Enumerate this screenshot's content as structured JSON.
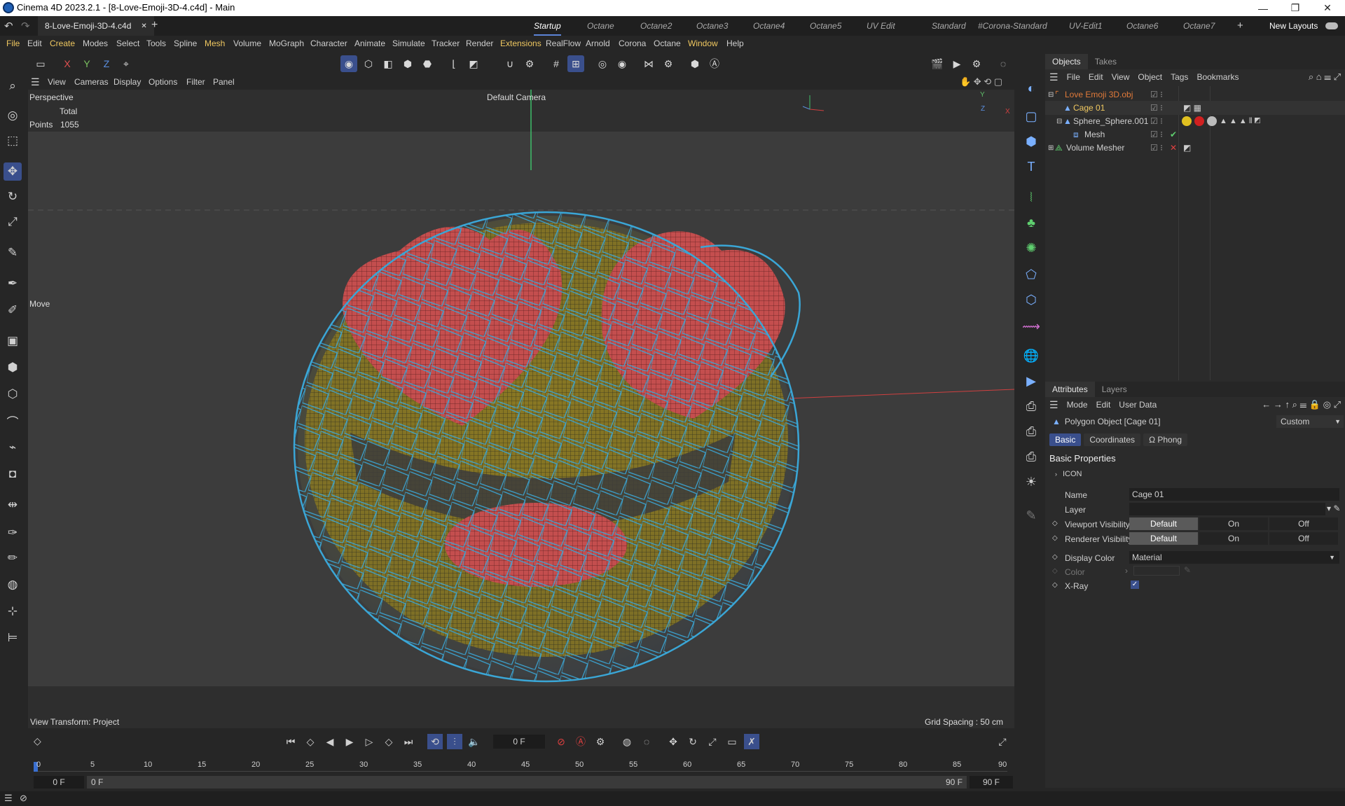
{
  "window": {
    "title": "Cinema 4D 2023.2.1 - [8-Love-Emoji-3D-4.c4d] - Main",
    "controls": [
      "—",
      "❐",
      "✕"
    ]
  },
  "doc_tab": {
    "label": "8-Love-Emoji-3D-4.c4d",
    "close": "✕",
    "add": "+"
  },
  "layout_tabs": [
    "Startup",
    "Octane",
    "Octane2",
    "Octane3",
    "Octane4",
    "Octane5",
    "UV Edit",
    "Standard",
    "#Corona-Standard",
    "UV-Edit1",
    "Octane6",
    "Octane7"
  ],
  "new_layouts": "New Layouts",
  "menus": [
    "File",
    "Edit",
    "Create",
    "Modes",
    "Select",
    "Tools",
    "Spline",
    "Mesh",
    "Volume",
    "MoGraph",
    "Character",
    "Animate",
    "Simulate",
    "Tracker",
    "Render",
    "Extensions",
    "RealFlow",
    "Arnold",
    "Corona",
    "Octane",
    "Window",
    "Help"
  ],
  "axis_toggles": [
    "X",
    "Y",
    "Z"
  ],
  "viewport_menu": [
    "View",
    "Cameras",
    "Display",
    "Options",
    "Filter",
    "Panel"
  ],
  "viewport": {
    "projection": "Perspective",
    "camera": "Default Camera",
    "stats_header": "Total",
    "stats_label": "Points",
    "stats_value": "1055",
    "tool_name": "Move",
    "view_transform": "View Transform: Project",
    "grid_spacing": "Grid Spacing : 50 cm",
    "axis_labels": [
      "Y",
      "Z",
      "X"
    ]
  },
  "objects_panel": {
    "tabs": [
      "Objects",
      "Takes"
    ],
    "menu": [
      "File",
      "Edit",
      "View",
      "Object",
      "Tags",
      "Bookmarks"
    ],
    "items": [
      {
        "name": "Love Emoji 3D.obj",
        "color": "#e07a3a"
      },
      {
        "name": "Cage 01",
        "color": "#f0c860"
      },
      {
        "name": "Sphere_Sphere.001",
        "color": "#cfcfcf"
      },
      {
        "name": "Mesh",
        "color": "#cfcfcf"
      },
      {
        "name": "Volume Mesher",
        "color": "#cfcfcf"
      }
    ]
  },
  "attributes_panel": {
    "tabs": [
      "Attributes",
      "Layers"
    ],
    "menu": [
      "Mode",
      "Edit",
      "User Data"
    ],
    "object_title": "Polygon Object [Cage 01]",
    "preset": "Custom",
    "subtabs": [
      "Basic",
      "Coordinates",
      "Phong"
    ],
    "section": "Basic Properties",
    "group": "ICON",
    "fields": {
      "name_label": "Name",
      "name_value": "Cage 01",
      "layer_label": "Layer",
      "viewport_vis_label": "Viewport Visibility",
      "renderer_vis_label": "Renderer Visibility",
      "vis_options": [
        "Default",
        "On",
        "Off"
      ],
      "display_color_label": "Display Color",
      "display_color_value": "Material",
      "color_label": "Color",
      "xray_label": "X-Ray",
      "xray_checked": true
    }
  },
  "timeline": {
    "current_frame": "0 F",
    "ticks": [
      "0",
      "5",
      "10",
      "15",
      "20",
      "25",
      "30",
      "35",
      "40",
      "45",
      "50",
      "55",
      "60",
      "65",
      "70",
      "75",
      "80",
      "85",
      "90"
    ],
    "range_start": "0 F",
    "range_start2": "0 F",
    "range_end": "90 F",
    "range_end2": "90 F"
  },
  "colors": {
    "accent": "#3a4f8c",
    "cage_wire": "#3aa6d6",
    "emoji_yellow": "#b8a030",
    "heart_red": "#c84a4a",
    "bg": "#262626"
  }
}
